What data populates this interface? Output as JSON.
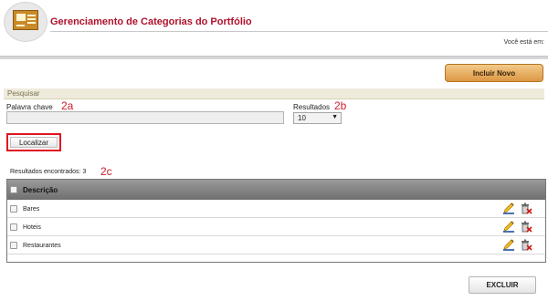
{
  "header": {
    "title": "Gerenciamento de Categorias do Portfólio",
    "breadcrumb_label": "Você está em:"
  },
  "toolbar": {
    "include_label": "Incluir Novo"
  },
  "search": {
    "section_label": "Pesquisar",
    "keyword_label": "Palavra chave",
    "keyword_value": "",
    "results_label": "Resultados",
    "results_value": "10",
    "locate_label": "Localizar"
  },
  "annotations": {
    "a": "2a",
    "b": "2b",
    "c": "2c"
  },
  "results": {
    "label": "Resultados encontrados: 3",
    "header": "Descrição",
    "rows": [
      {
        "label": "Bares"
      },
      {
        "label": "Hoteis"
      },
      {
        "label": "Restaurantes"
      }
    ]
  },
  "footer": {
    "delete_label": "EXCLUIR"
  },
  "colors": {
    "title": "#b0112c",
    "annotation": "#cc1c2e",
    "include_button": "#dd9844",
    "highlight_border": "#e0151f"
  }
}
